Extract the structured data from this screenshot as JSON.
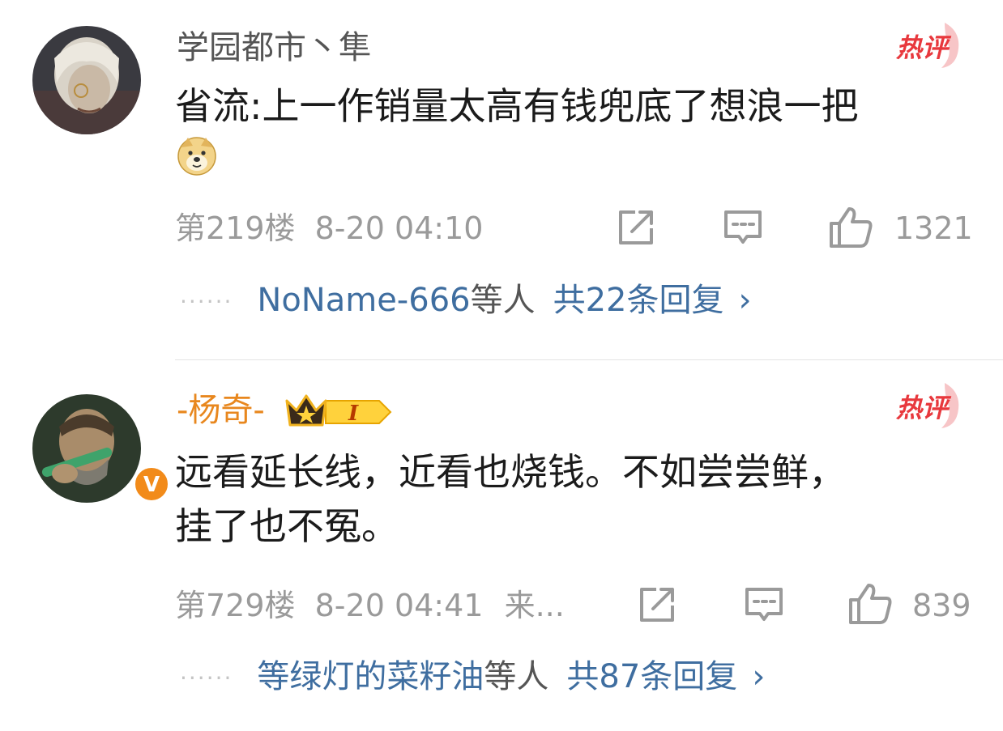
{
  "comments": [
    {
      "username": "学园都市丶隼",
      "hot_label": "热评",
      "text_lines": [
        "省流:上一作销量太高有钱兜底了想浪一把"
      ],
      "emoji": "doge-emoji",
      "floor": "第219楼",
      "time": "8-20 04:10",
      "likes": "1321",
      "reply_who": "NoName-666",
      "reply_suffix": "等人",
      "reply_total": "共22条回复",
      "dots": "······"
    },
    {
      "username": "-杨奇-",
      "vip_level": "I",
      "hot_label": "热评",
      "text_lines": [
        "远看延长线，近看也烧钱。不如尝尝鲜，",
        "挂了也不冤。"
      ],
      "floor": "第729楼",
      "time": "8-20 04:41",
      "source": "来...",
      "likes": "839",
      "reply_who": "等绿灯的菜籽油",
      "reply_suffix": "等人",
      "reply_total": "共87条回复",
      "dots": "······",
      "verified_mark": "V"
    }
  ],
  "colors": {
    "link": "#3f6ea0",
    "vip_name": "#e8871e",
    "hot": "#e8383d",
    "meta": "#9a9a9a"
  },
  "icons": {
    "share": "share-icon",
    "comment": "comment-icon",
    "like": "thumbs-up-icon",
    "chevron": "chevron-right-icon"
  }
}
